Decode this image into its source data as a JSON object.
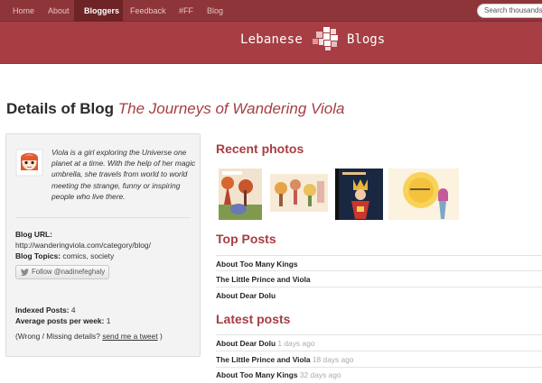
{
  "nav": {
    "items": [
      "Home",
      "About",
      "Bloggers",
      "Feedback",
      "#FF",
      "Blog"
    ],
    "active": "Bloggers",
    "search_placeholder": "Search thousands"
  },
  "brand": {
    "left": "Lebanese",
    "right": "Blogs"
  },
  "page": {
    "title_prefix": "Details of Blog",
    "blog_name": "The Journeys of Wandering Viola"
  },
  "sidebar": {
    "description": "Viola is a girl exploring the Universe one planet at a time. With the help of her magic umbrella, she travels from world to world meeting the strange, funny or inspiring people who live there.",
    "blog_url_label": "Blog URL:",
    "blog_url": "http://wanderingviola.com/category/blog/",
    "topics_label": "Blog Topics:",
    "topics": "comics, society",
    "follow_button": "Follow @nadinefeghaly",
    "indexed_label": "Indexed Posts:",
    "indexed_value": "4",
    "avg_label": "Average posts per week:",
    "avg_value": "1",
    "details_prefix": "(Wrong / Missing details?",
    "details_link": "send me a tweet",
    "details_suffix": ")"
  },
  "recent_photos": {
    "title": "Recent photos"
  },
  "top_posts": {
    "title": "Top Posts",
    "items": [
      "About Too Many Kings",
      "The Little Prince and Viola",
      "About Dear Dolu"
    ]
  },
  "latest_posts": {
    "title": "Latest posts",
    "items": [
      {
        "title": "About Dear Dolu",
        "ago": "1 days ago"
      },
      {
        "title": "The Little Prince and Viola",
        "ago": "18 days ago"
      },
      {
        "title": "About Too Many Kings",
        "ago": "32 days ago"
      }
    ]
  },
  "colors": {
    "accent": "#a63e43",
    "nav_bg": "#8e3539",
    "nav_active": "#6e2327"
  }
}
